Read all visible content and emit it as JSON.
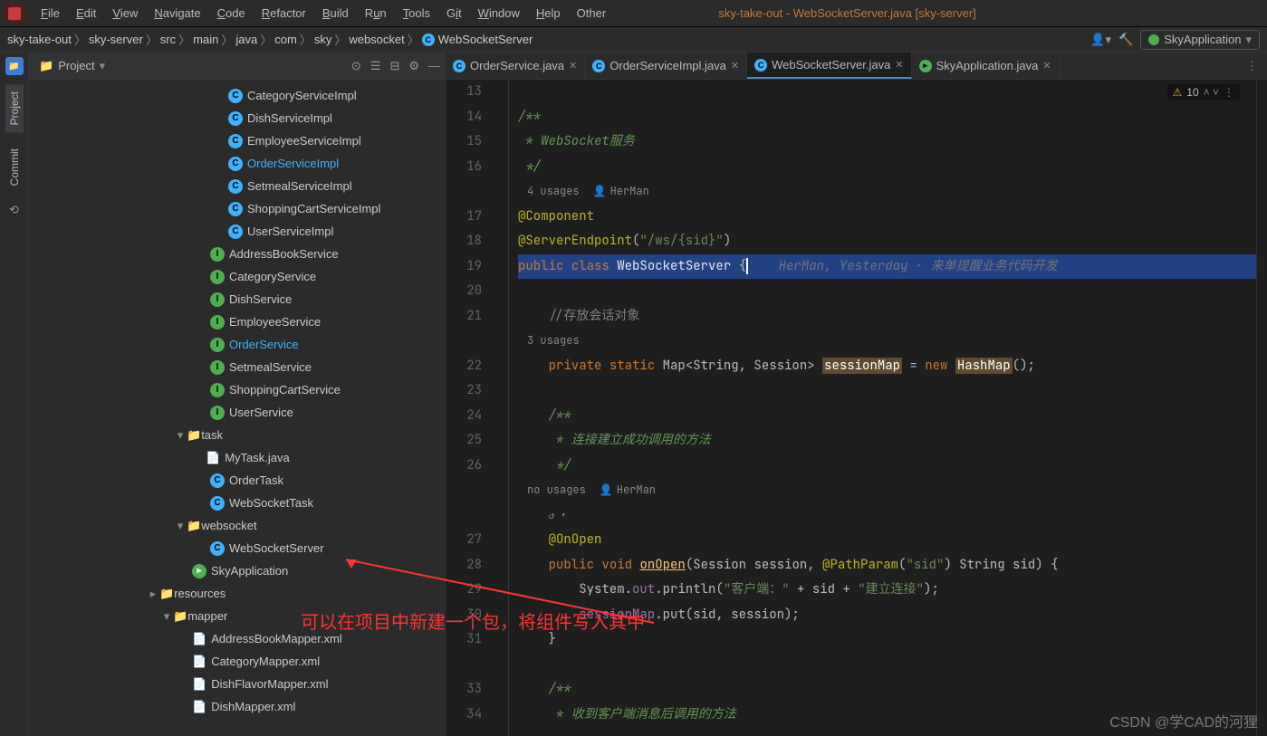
{
  "menu": {
    "file": "File",
    "edit": "Edit",
    "view": "View",
    "navigate": "Navigate",
    "code": "Code",
    "refactor": "Refactor",
    "build": "Build",
    "run": "Run",
    "tools": "Tools",
    "git": "Git",
    "window": "Window",
    "help": "Help",
    "other": "Other"
  },
  "window_title": "sky-take-out - WebSocketServer.java [sky-server]",
  "breadcrumbs": [
    "sky-take-out",
    "sky-server",
    "src",
    "main",
    "java",
    "com",
    "sky",
    "websocket",
    "WebSocketServer"
  ],
  "run_config": "SkyApplication",
  "sidebar": {
    "project": "Project",
    "commit": "Commit"
  },
  "project_label": "Project",
  "tree": [
    {
      "indent": 220,
      "icon": "c",
      "label": "CategoryServiceImpl"
    },
    {
      "indent": 220,
      "icon": "c",
      "label": "DishServiceImpl"
    },
    {
      "indent": 220,
      "icon": "c",
      "label": "EmployeeServiceImpl"
    },
    {
      "indent": 220,
      "icon": "c",
      "label": "OrderServiceImpl",
      "hl": true
    },
    {
      "indent": 220,
      "icon": "c",
      "label": "SetmealServiceImpl"
    },
    {
      "indent": 220,
      "icon": "c",
      "label": "ShoppingCartServiceImpl"
    },
    {
      "indent": 220,
      "icon": "c",
      "label": "UserServiceImpl"
    },
    {
      "indent": 200,
      "icon": "i",
      "label": "AddressBookService"
    },
    {
      "indent": 200,
      "icon": "i",
      "label": "CategoryService"
    },
    {
      "indent": 200,
      "icon": "i",
      "label": "DishService"
    },
    {
      "indent": 200,
      "icon": "i",
      "label": "EmployeeService"
    },
    {
      "indent": 200,
      "icon": "i",
      "label": "OrderService",
      "hl": true
    },
    {
      "indent": 200,
      "icon": "i",
      "label": "SetmealService"
    },
    {
      "indent": 200,
      "icon": "i",
      "label": "ShoppingCartService"
    },
    {
      "indent": 200,
      "icon": "i",
      "label": "UserService"
    },
    {
      "indent": 160,
      "icon": "fold",
      "label": "task",
      "arrow": "v"
    },
    {
      "indent": 195,
      "icon": "java",
      "label": "MyTask.java"
    },
    {
      "indent": 200,
      "icon": "c",
      "label": "OrderTask"
    },
    {
      "indent": 200,
      "icon": "c",
      "label": "WebSocketTask"
    },
    {
      "indent": 160,
      "icon": "fold",
      "label": "websocket",
      "arrow": "v"
    },
    {
      "indent": 200,
      "icon": "c",
      "label": "WebSocketServer"
    },
    {
      "indent": 180,
      "icon": "run",
      "label": "SkyApplication"
    },
    {
      "indent": 130,
      "icon": "fold",
      "label": "resources",
      "arrow": ">"
    },
    {
      "indent": 145,
      "icon": "fold",
      "label": "mapper",
      "arrow": "v"
    },
    {
      "indent": 180,
      "icon": "xml",
      "label": "AddressBookMapper.xml"
    },
    {
      "indent": 180,
      "icon": "xml",
      "label": "CategoryMapper.xml"
    },
    {
      "indent": 180,
      "icon": "xml",
      "label": "DishFlavorMapper.xml"
    },
    {
      "indent": 180,
      "icon": "xml",
      "label": "DishMapper.xml"
    }
  ],
  "tabs": [
    {
      "label": "OrderService.java",
      "icon": "c"
    },
    {
      "label": "OrderServiceImpl.java",
      "icon": "c"
    },
    {
      "label": "WebSocketServer.java",
      "icon": "c",
      "active": true
    },
    {
      "label": "SkyApplication.java",
      "icon": "run"
    }
  ],
  "warnings": "10",
  "gutter_lines": [
    "13",
    "14",
    "15",
    "16",
    "",
    "17",
    "18",
    "19",
    "20",
    "21",
    "",
    "22",
    "23",
    "24",
    "25",
    "26",
    "",
    "",
    "27",
    "28",
    "29",
    "30",
    "31",
    "",
    "33",
    "34"
  ],
  "usage_4": "4 usages",
  "usage_3": "3 usages",
  "usage_no": "no usages",
  "author": "HerMan",
  "inline_author": "HerMan, Yesterday · 来单提醒业务代码开发",
  "annotation_text": "可以在项目中新建一个包，将组件写入其中",
  "watermark": "CSDN @学CAD的河狸"
}
